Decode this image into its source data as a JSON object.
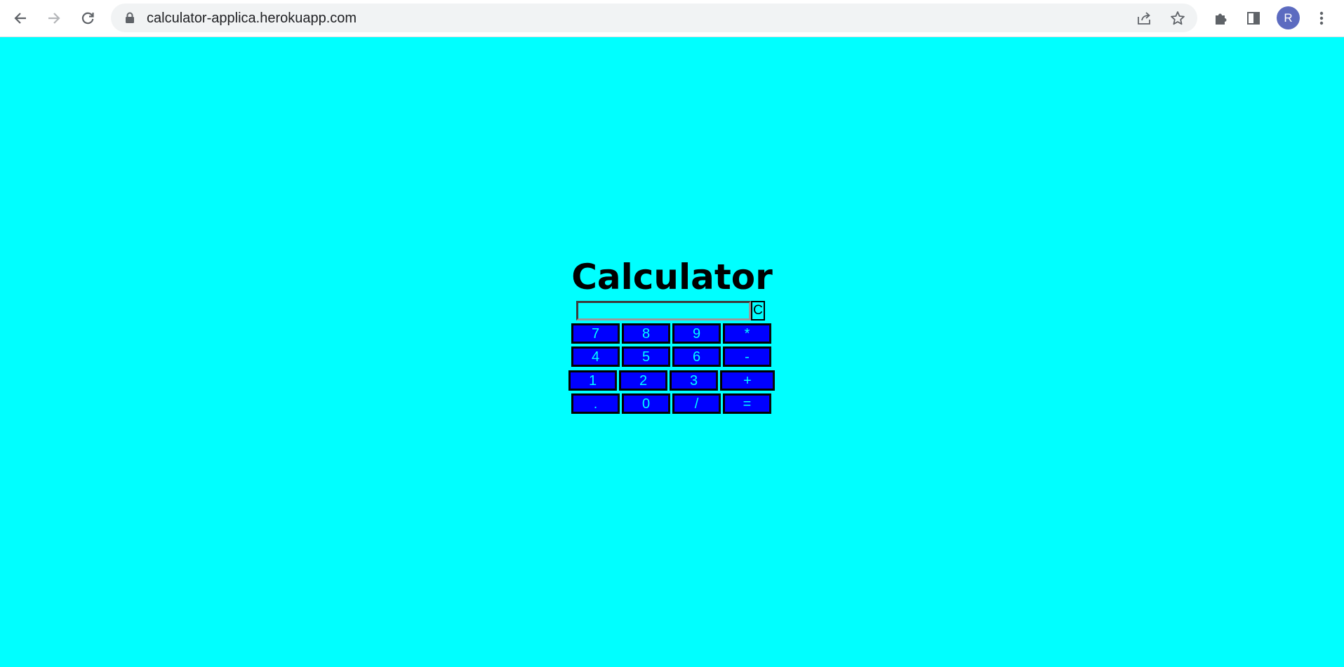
{
  "browser": {
    "url": "calculator-applica.herokuapp.com",
    "avatar_initial": "R",
    "icons": {
      "back": "back-arrow-icon",
      "forward": "forward-arrow-icon",
      "reload": "reload-icon",
      "lock": "lock-icon",
      "share": "share-icon",
      "bookmark": "star-icon",
      "extensions": "puzzle-icon",
      "side_panel": "side-panel-icon",
      "menu": "kebab-menu-icon"
    }
  },
  "page": {
    "background": "#00ffff",
    "title": "Calculator",
    "display_value": "",
    "clear_label": "C",
    "key_color": "#0000ff",
    "key_text_color": "#00ffff",
    "rows": [
      [
        "7",
        "8",
        "9",
        "*"
      ],
      [
        "4",
        "5",
        "6",
        "-"
      ],
      [
        "1",
        "2",
        "3",
        "+"
      ],
      [
        ".",
        "0",
        "/",
        "="
      ]
    ]
  }
}
